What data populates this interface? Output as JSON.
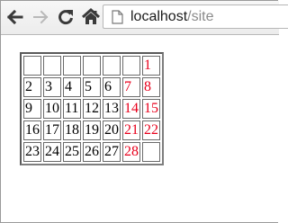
{
  "browser": {
    "nav_icons": [
      "back-arrow-icon",
      "forward-arrow-icon",
      "reload-icon",
      "home-icon"
    ],
    "address_bar": {
      "icon": "page-icon",
      "host": "localhost",
      "path": "/site"
    }
  },
  "calendar": {
    "weekend_color": "#e8001c",
    "text_color": "#000000",
    "rows": [
      [
        {
          "text": "",
          "weekend": false
        },
        {
          "text": "",
          "weekend": false
        },
        {
          "text": "",
          "weekend": false
        },
        {
          "text": "",
          "weekend": false
        },
        {
          "text": "",
          "weekend": false
        },
        {
          "text": "",
          "weekend": false
        },
        {
          "text": "1",
          "weekend": true
        }
      ],
      [
        {
          "text": "2",
          "weekend": false
        },
        {
          "text": "3",
          "weekend": false
        },
        {
          "text": "4",
          "weekend": false
        },
        {
          "text": "5",
          "weekend": false
        },
        {
          "text": "6",
          "weekend": false
        },
        {
          "text": "7",
          "weekend": true
        },
        {
          "text": "8",
          "weekend": true
        }
      ],
      [
        {
          "text": "9",
          "weekend": false
        },
        {
          "text": "10",
          "weekend": false
        },
        {
          "text": "11",
          "weekend": false
        },
        {
          "text": "12",
          "weekend": false
        },
        {
          "text": "13",
          "weekend": false
        },
        {
          "text": "14",
          "weekend": true
        },
        {
          "text": "15",
          "weekend": true
        }
      ],
      [
        {
          "text": "16",
          "weekend": false
        },
        {
          "text": "17",
          "weekend": false
        },
        {
          "text": "18",
          "weekend": false
        },
        {
          "text": "19",
          "weekend": false
        },
        {
          "text": "20",
          "weekend": false
        },
        {
          "text": "21",
          "weekend": true
        },
        {
          "text": "22",
          "weekend": true
        }
      ],
      [
        {
          "text": "23",
          "weekend": false
        },
        {
          "text": "24",
          "weekend": false
        },
        {
          "text": "25",
          "weekend": false
        },
        {
          "text": "26",
          "weekend": false
        },
        {
          "text": "27",
          "weekend": false
        },
        {
          "text": "28",
          "weekend": true
        },
        {
          "text": "",
          "weekend": false
        }
      ]
    ]
  }
}
